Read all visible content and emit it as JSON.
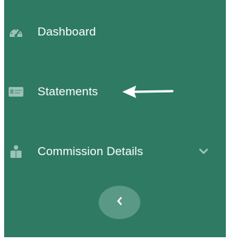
{
  "sidebar": {
    "background": "#2e7a63",
    "items": [
      {
        "label": "Dashboard",
        "icon": "dashboard-gauge-icon"
      },
      {
        "label": "Statements",
        "icon": "statement-card-icon"
      },
      {
        "label": "Commission Details",
        "icon": "commission-person-icon",
        "expand_icon": "chevron-down-icon"
      }
    ],
    "collapse_button": {
      "icon": "chevron-left-icon"
    }
  },
  "annotation": {
    "icon": "arrow-left-icon",
    "color": "#ffffff"
  }
}
